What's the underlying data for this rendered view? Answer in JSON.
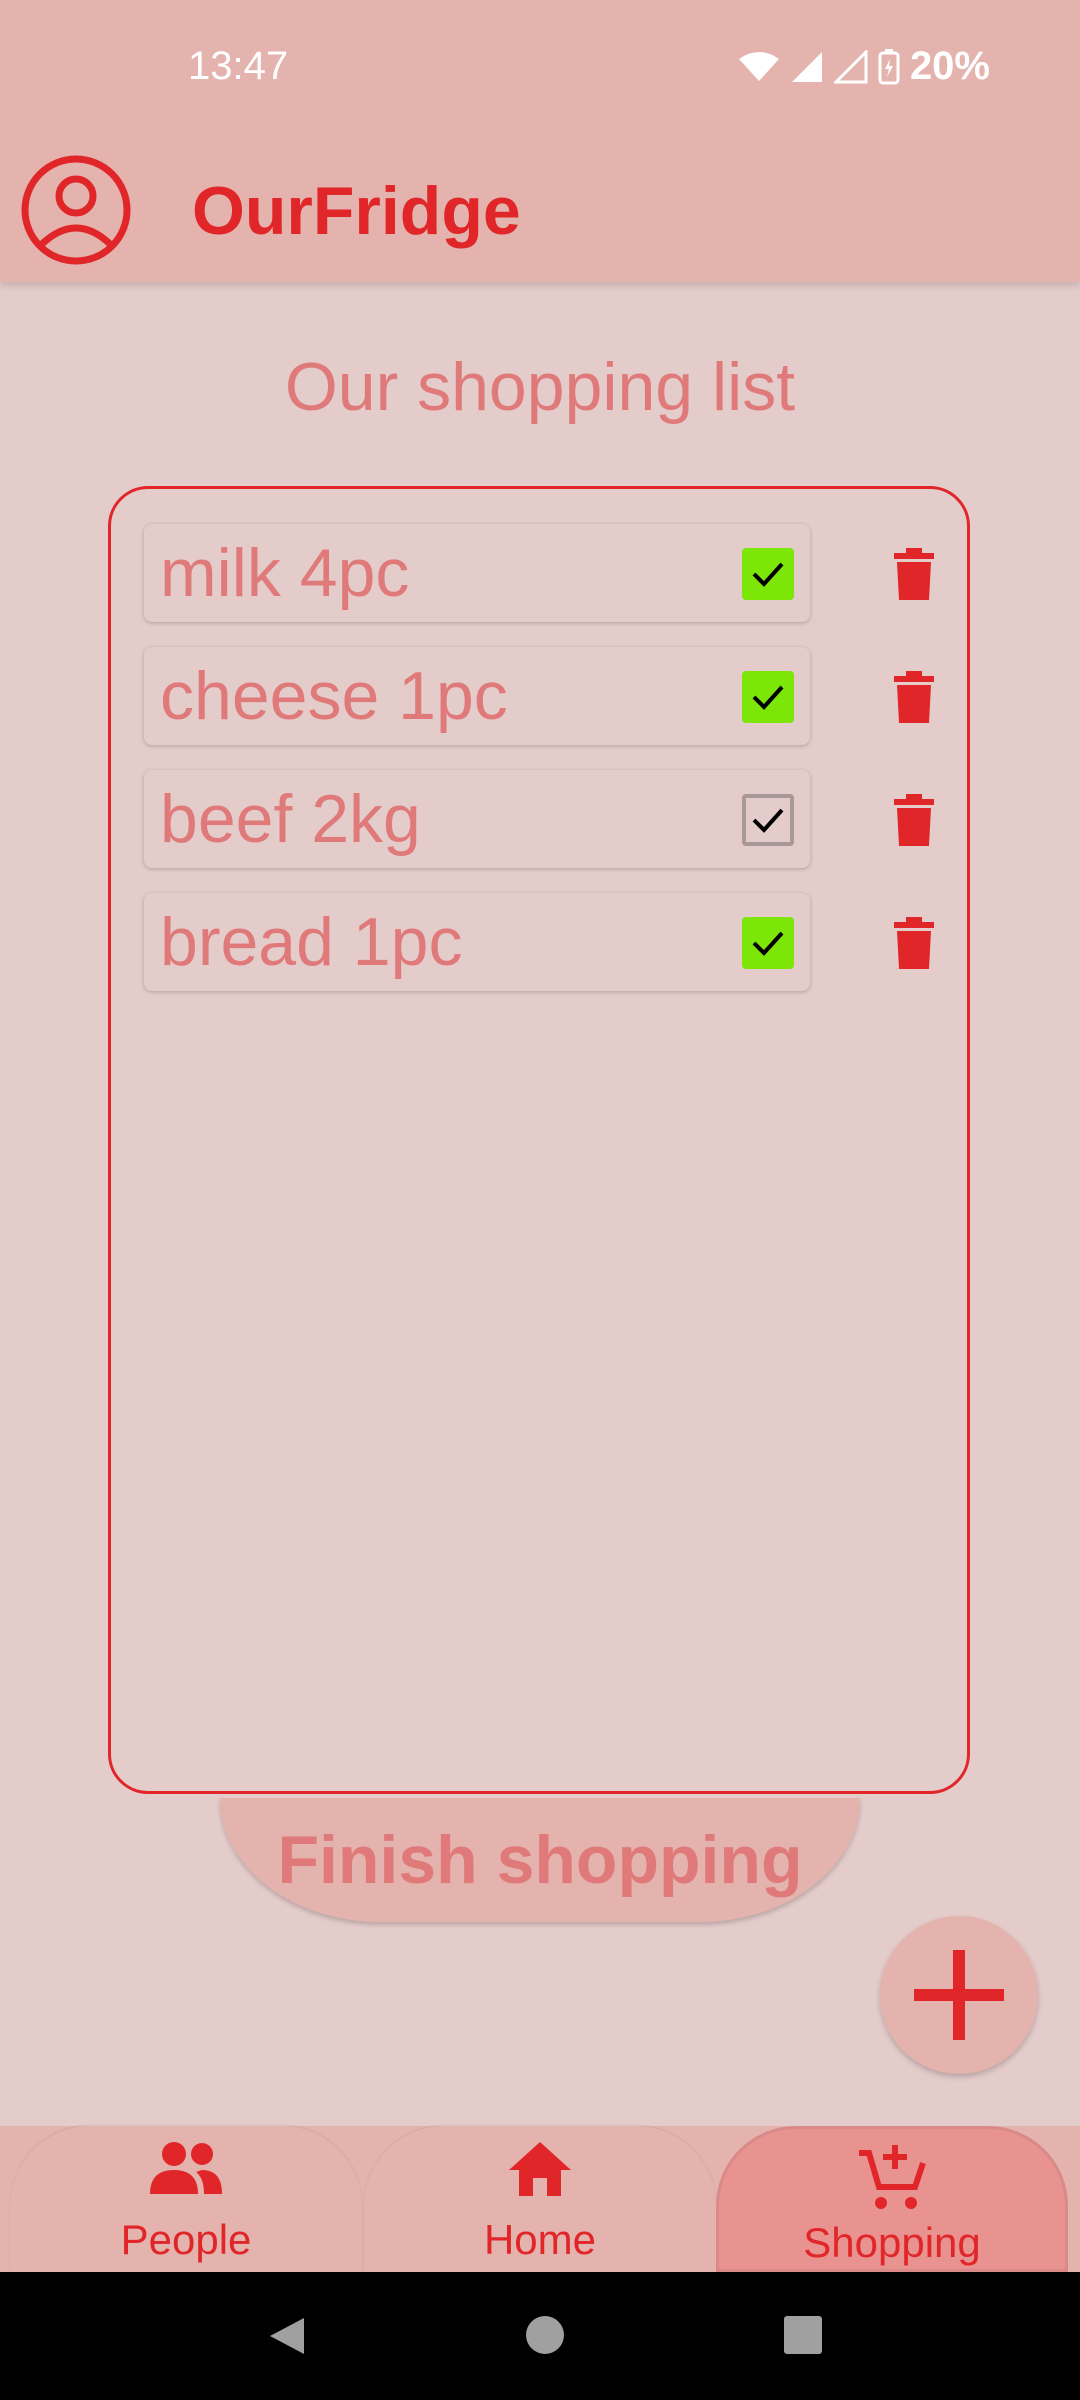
{
  "status_bar": {
    "time": "13:47",
    "battery": "20%"
  },
  "app_bar": {
    "title": "OurFridge"
  },
  "page": {
    "title": "Our shopping list"
  },
  "shopping_list": {
    "items": [
      {
        "label": "milk 4pc",
        "checked": true
      },
      {
        "label": "cheese 1pc",
        "checked": true
      },
      {
        "label": "beef 2kg",
        "checked": false
      },
      {
        "label": "bread 1pc",
        "checked": true
      }
    ]
  },
  "actions": {
    "finish_label": "Finish shopping"
  },
  "bottom_nav": {
    "tabs": [
      {
        "label": "People",
        "icon": "people-icon",
        "active": false
      },
      {
        "label": "Home",
        "icon": "home-icon",
        "active": false
      },
      {
        "label": "Shopping",
        "icon": "cart-add-icon",
        "active": true
      }
    ]
  },
  "colors": {
    "accent": "#e02629",
    "muted_text": "#e07a7a",
    "checked": "#7ce706",
    "background": "#e4cccb",
    "bar": "#e4b3ad"
  }
}
